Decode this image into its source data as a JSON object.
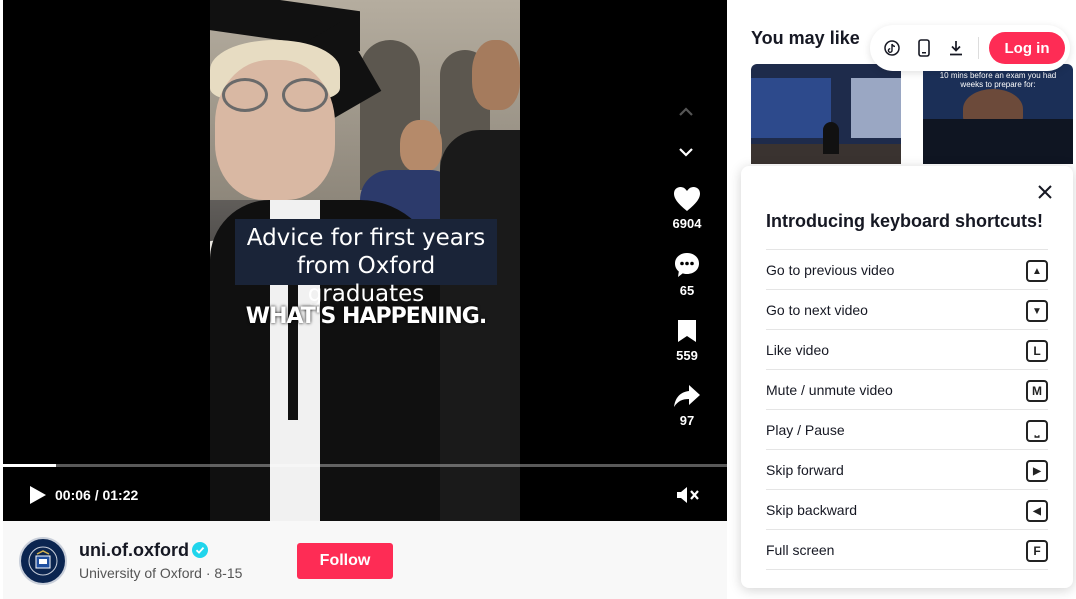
{
  "video": {
    "title_line1": "Advice for first years",
    "title_line2": "from Oxford graduates",
    "overlay_caption": "WHAT'S HAPPENING.",
    "time": "00:06 / 01:22",
    "progress_fraction": 0.073
  },
  "actions": {
    "likes": "6904",
    "comments": "65",
    "saves": "559",
    "shares": "97"
  },
  "author": {
    "username": "uni.of.oxford",
    "display_name": "University of Oxford",
    "date": "8-15",
    "subline": "University of Oxford · 8-15",
    "follow_label": "Follow"
  },
  "sidebar": {
    "heading": "You may like",
    "login_label": "Log in",
    "thumb2_caption": "10 mins before an exam you had weeks to prepare for:",
    "icons": [
      "tiktok-icon",
      "mobile-icon",
      "download-icon"
    ]
  },
  "shortcuts": {
    "title": "Introducing keyboard shortcuts!",
    "items": [
      {
        "label": "Go to previous video",
        "key": "▲"
      },
      {
        "label": "Go to next video",
        "key": "▼"
      },
      {
        "label": "Like video",
        "key": "L"
      },
      {
        "label": "Mute / unmute video",
        "key": "M"
      },
      {
        "label": "Play / Pause",
        "key": "⎵"
      },
      {
        "label": "Skip forward",
        "key": "▶"
      },
      {
        "label": "Skip backward",
        "key": "◀"
      },
      {
        "label": "Full screen",
        "key": "F"
      }
    ]
  },
  "colors": {
    "accent": "#fe2c55",
    "verified": "#20d5ec"
  }
}
